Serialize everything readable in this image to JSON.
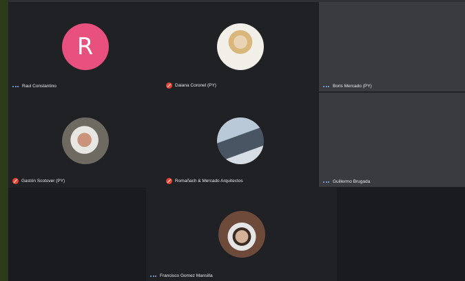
{
  "participants": {
    "raul": {
      "name": "Raul Constantino",
      "initial": "R",
      "mic": "active"
    },
    "daiana": {
      "name": "Daiana Coronel (PY)",
      "mic": "muted"
    },
    "boris": {
      "name": "Boris Mercado (PY)",
      "mic": "active"
    },
    "gaston": {
      "name": "Gastón Scotover (PY)",
      "mic": "muted"
    },
    "romanach": {
      "name": "Romañach & Mercado Arquitectos",
      "mic": "muted"
    },
    "guillermo": {
      "name": "Guillermo Brugada",
      "mic": "active"
    },
    "francisco": {
      "name": "Francisco Gomez Mansilla",
      "mic": "active"
    }
  },
  "colors": {
    "background": "#202124",
    "avatar_r": "#e8507e",
    "muted": "#ea4335",
    "speaking": "#8ab4f8"
  }
}
